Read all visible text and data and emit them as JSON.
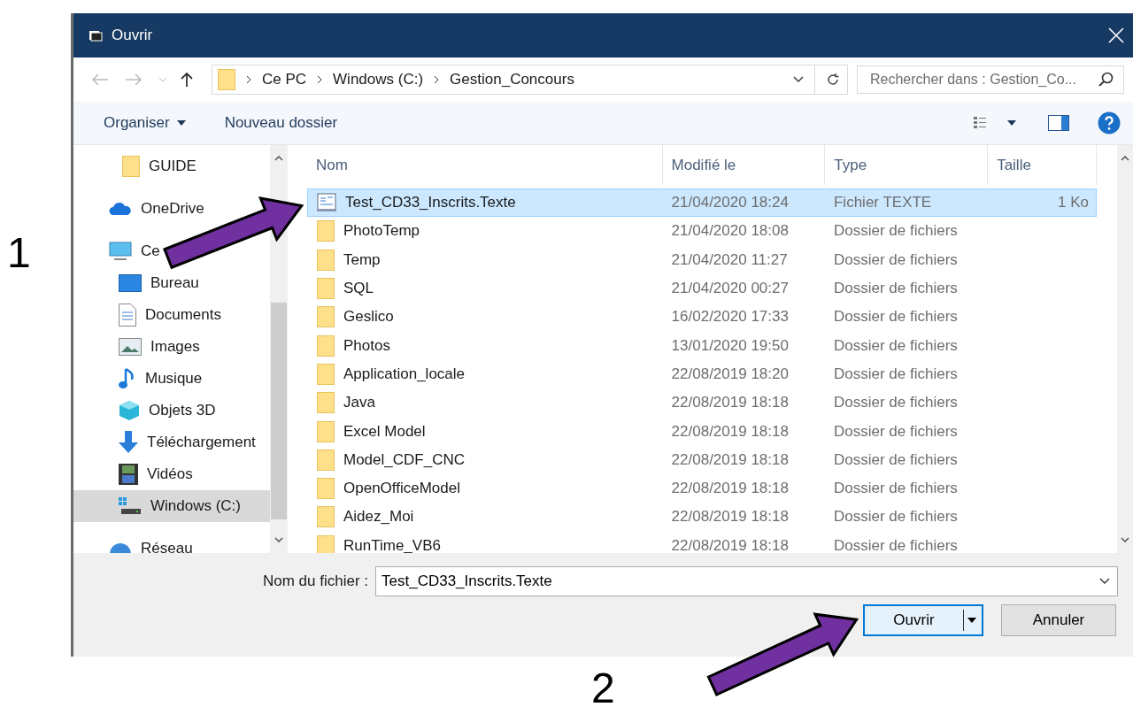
{
  "window": {
    "title": "Ouvrir"
  },
  "address": {
    "path": [
      "Ce PC",
      "Windows (C:)",
      "Gestion_Concours"
    ]
  },
  "search": {
    "placeholder": "Rechercher dans : Gestion_Co..."
  },
  "toolbar": {
    "organize": "Organiser",
    "new_folder": "Nouveau dossier"
  },
  "nav": {
    "items": [
      {
        "kind": "folder",
        "label": "GUIDE",
        "selected": false
      },
      {
        "kind": "cloud",
        "label": "OneDrive",
        "selected": false
      },
      {
        "kind": "pc",
        "label": "Ce",
        "selected": false,
        "children": [
          {
            "kind": "desktop",
            "label": "Bureau",
            "selected": false
          },
          {
            "kind": "documents",
            "label": "Documents",
            "selected": false
          },
          {
            "kind": "images",
            "label": "Images",
            "selected": false
          },
          {
            "kind": "music",
            "label": "Musique",
            "selected": false
          },
          {
            "kind": "objects3d",
            "label": "Objets 3D",
            "selected": false
          },
          {
            "kind": "download",
            "label": "Téléchargement",
            "selected": false
          },
          {
            "kind": "videos",
            "label": "Vidéos",
            "selected": false
          },
          {
            "kind": "drive",
            "label": "Windows (C:)",
            "selected": true
          }
        ]
      },
      {
        "kind": "network",
        "label": "Réseau",
        "selected": false
      }
    ]
  },
  "table": {
    "columns": [
      "Nom",
      "Modifié le",
      "Type",
      "Taille"
    ],
    "rows": [
      {
        "kind": "file",
        "name": "Test_CD33_Inscrits.Texte",
        "modified": "21/04/2020 18:24",
        "type": "Fichier TEXTE",
        "size": "1 Ko",
        "selected": true
      },
      {
        "kind": "folder",
        "name": "PhotoTemp",
        "modified": "21/04/2020 18:08",
        "type": "Dossier de fichiers",
        "selected": false
      },
      {
        "kind": "folder",
        "name": "Temp",
        "modified": "21/04/2020 11:27",
        "type": "Dossier de fichiers",
        "selected": false
      },
      {
        "kind": "folder",
        "name": "SQL",
        "modified": "21/04/2020 00:27",
        "type": "Dossier de fichiers",
        "selected": false
      },
      {
        "kind": "folder",
        "name": "Geslico",
        "modified": "16/02/2020 17:33",
        "type": "Dossier de fichiers",
        "selected": false
      },
      {
        "kind": "folder",
        "name": "Photos",
        "modified": "13/01/2020 19:50",
        "type": "Dossier de fichiers",
        "selected": false
      },
      {
        "kind": "folder",
        "name": "Application_locale",
        "modified": "22/08/2019 18:20",
        "type": "Dossier de fichiers",
        "selected": false
      },
      {
        "kind": "folder",
        "name": "Java",
        "modified": "22/08/2019 18:18",
        "type": "Dossier de fichiers",
        "selected": false
      },
      {
        "kind": "folder",
        "name": "Excel Model",
        "modified": "22/08/2019 18:18",
        "type": "Dossier de fichiers",
        "selected": false
      },
      {
        "kind": "folder",
        "name": "Model_CDF_CNC",
        "modified": "22/08/2019 18:18",
        "type": "Dossier de fichiers",
        "selected": false
      },
      {
        "kind": "folder",
        "name": "OpenOfficeModel",
        "modified": "22/08/2019 18:18",
        "type": "Dossier de fichiers",
        "selected": false
      },
      {
        "kind": "folder",
        "name": "Aidez_Moi",
        "modified": "22/08/2019 18:18",
        "type": "Dossier de fichiers",
        "selected": false
      },
      {
        "kind": "folder",
        "name": "RunTime_VB6",
        "modified": "22/08/2019 18:18",
        "type": "Dossier de fichiers",
        "selected": false
      }
    ]
  },
  "filename": {
    "label": "Nom du fichier :",
    "value": "Test_CD33_Inscrits.Texte"
  },
  "buttons": {
    "open": "Ouvrir",
    "cancel": "Annuler"
  },
  "annotations": [
    {
      "label": "1"
    },
    {
      "label": "2"
    }
  ]
}
